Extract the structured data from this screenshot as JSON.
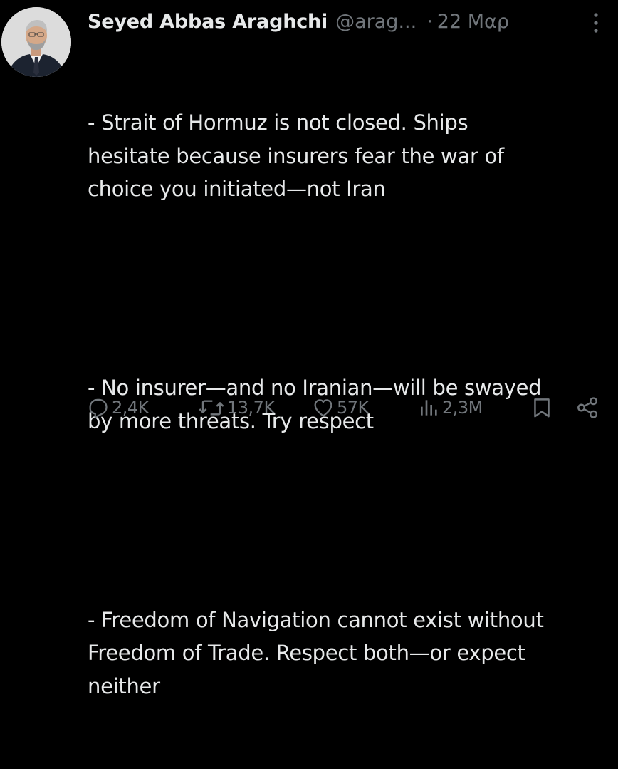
{
  "tweet": {
    "author": {
      "display_name": "Seyed Abbas Araghchi",
      "handle": "@arag...",
      "avatar_icon": "profile-photo"
    },
    "separator": "·",
    "date": "22 Μαρ",
    "paragraphs": [
      "- Strait of Hormuz is not closed. Ships\nhesitate because insurers fear the war of\nchoice you initiated—not Iran",
      "- No insurer—and no Iranian—will be swayed\nby more threats. Try respect",
      "- Freedom of Navigation cannot exist without\nFreedom of Trade. Respect both—or expect\nneither"
    ],
    "actions": {
      "replies": "2,4K",
      "reposts": "13,7K",
      "likes": "57K",
      "views": "2,3M"
    }
  },
  "colors": {
    "background": "#000000",
    "text": "#e7e9ea",
    "secondary": "#71767b"
  }
}
